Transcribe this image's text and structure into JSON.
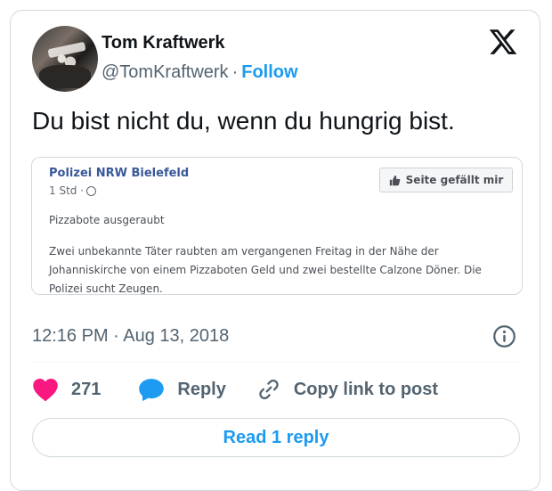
{
  "author": {
    "name": "Tom Kraftwerk",
    "handle": "@TomKraftwerk",
    "separator": "·",
    "follow_label": "Follow"
  },
  "tweet": {
    "text": "Du bist nicht du, wenn du hungrig bist."
  },
  "embedded_post": {
    "page_name": "Polizei NRW Bielefeld",
    "meta": "1 Std ·",
    "like_button_label": "Seite gefällt mir",
    "headline": "Pizzabote ausgeraubt",
    "body": "Zwei unbekannte Täter raubten am vergangenen Freitag in der Nähe der Johanniskirche von einem Pizzaboten Geld und zwei bestellte Calzone Döner. Die Polizei sucht Zeugen."
  },
  "timestamp": "12:16 PM · Aug 13, 2018",
  "actions": {
    "like_count": "271",
    "reply_label": "Reply",
    "copy_link_label": "Copy link to post"
  },
  "read_reply_label": "Read 1 reply",
  "colors": {
    "accent": "#1d9bf0",
    "heart": "#f91880",
    "secondary_text": "#536471",
    "fb_blue": "#385898"
  },
  "icons": [
    "x-logo-icon",
    "globe-icon",
    "thumbs-up-icon",
    "info-icon",
    "heart-icon",
    "reply-bubble-icon",
    "link-icon"
  ]
}
